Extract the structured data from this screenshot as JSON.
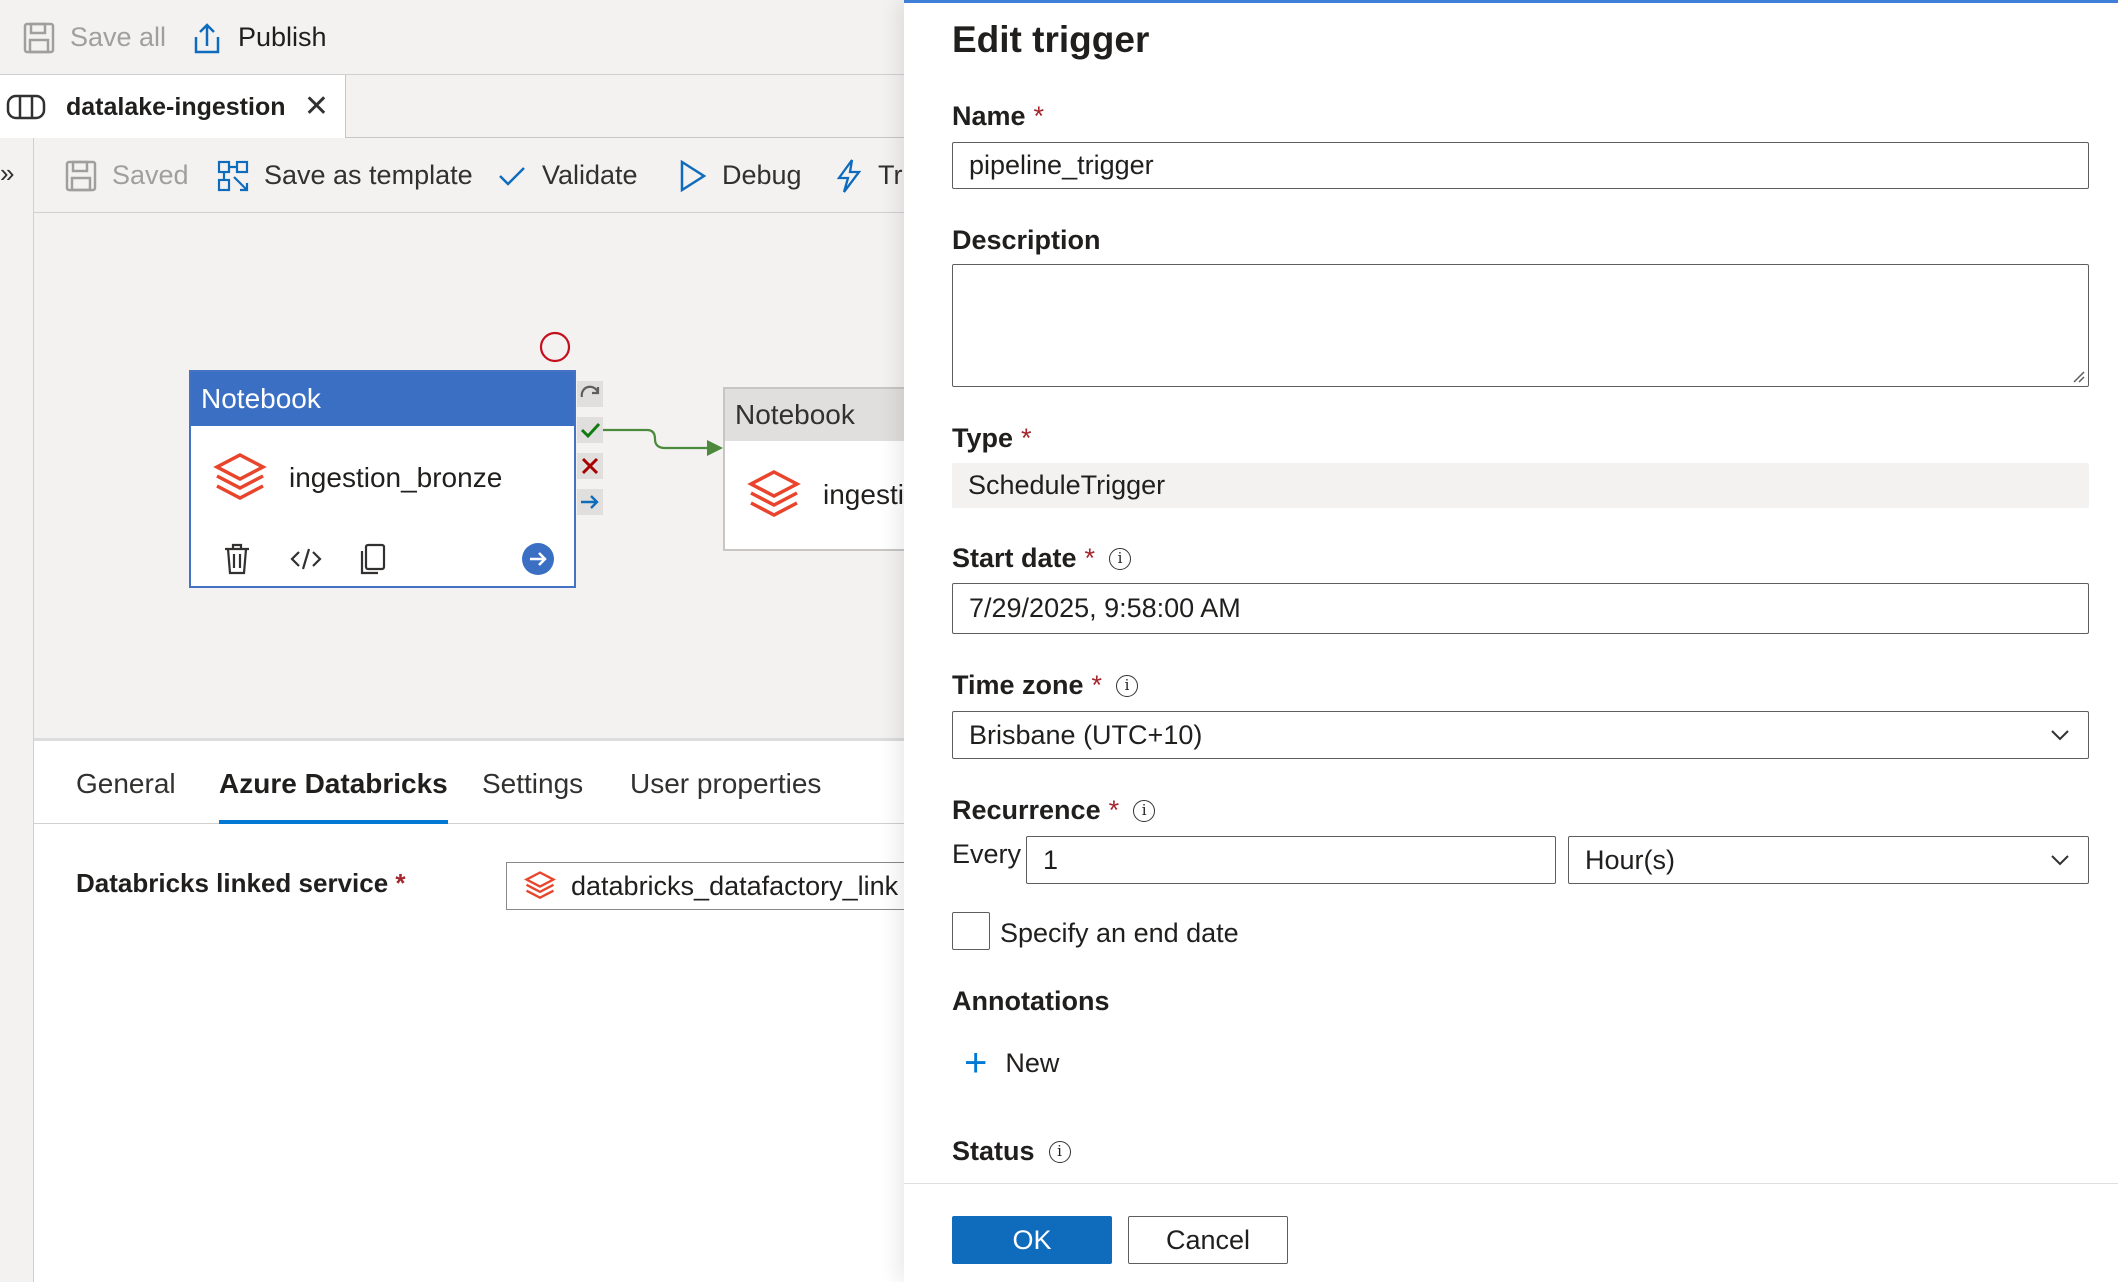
{
  "topbar": {
    "save_all": "Save all",
    "publish": "Publish"
  },
  "tab": {
    "title": "datalake-ingestion",
    "close": "✕"
  },
  "toolbar": {
    "saved": "Saved",
    "save_as_template": "Save as template",
    "validate": "Validate",
    "debug": "Debug",
    "trigger": "Tr"
  },
  "canvas": {
    "activity1": {
      "type": "Notebook",
      "name": "ingestion_bronze"
    },
    "activity2": {
      "type": "Notebook",
      "name": "ingesti"
    }
  },
  "properties": {
    "tabs": [
      "General",
      "Azure Databricks",
      "Settings",
      "User properties"
    ],
    "active_tab": "Azure Databricks",
    "linked_service_label": "Databricks linked service",
    "linked_service_value": "databricks_datafactory_link"
  },
  "panel": {
    "title": "Edit trigger",
    "required_mark": "*",
    "name_label": "Name",
    "name_value": "pipeline_trigger",
    "description_label": "Description",
    "description_value": "",
    "type_label": "Type",
    "type_value": "ScheduleTrigger",
    "start_date_label": "Start date",
    "start_date_value": "7/29/2025, 9:58:00 AM",
    "time_zone_label": "Time zone",
    "time_zone_value": "Brisbane (UTC+10)",
    "recurrence_label": "Recurrence",
    "every_label": "Every",
    "every_value": "1",
    "every_unit": "Hour(s)",
    "end_date_label": "Specify an end date",
    "annotations_label": "Annotations",
    "new_label": "New",
    "status_label": "Status",
    "ok_label": "OK",
    "cancel_label": "Cancel",
    "info_glyph": "i"
  },
  "colors": {
    "accent": "#0f6cbd",
    "activity_header": "#3a6fc4",
    "required": "#a4262c",
    "databricks": "#e8452c",
    "success": "#107c10",
    "failure": "#a80000"
  }
}
